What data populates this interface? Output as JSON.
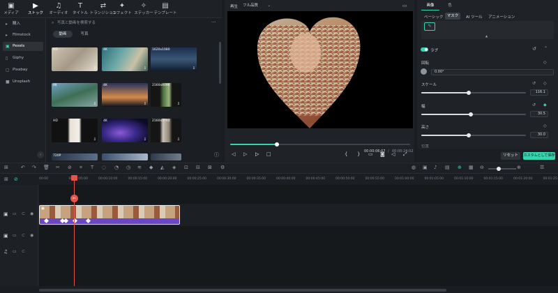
{
  "toolbar": {
    "tabs": [
      {
        "label": "メディア",
        "icon": "media-icon"
      },
      {
        "label": "ストック",
        "icon": "stock-icon"
      },
      {
        "label": "オーディオ",
        "icon": "audio-icon"
      },
      {
        "label": "タイトル",
        "icon": "title-icon"
      },
      {
        "label": "トランジション",
        "icon": "transition-icon"
      },
      {
        "label": "エフェクト",
        "icon": "effect-icon"
      },
      {
        "label": "ステッカー",
        "icon": "sticker-icon"
      },
      {
        "label": "テンプレート",
        "icon": "template-icon"
      }
    ]
  },
  "sidebar": {
    "items": [
      {
        "label": "購入"
      },
      {
        "label": "Filmstock"
      },
      {
        "label": "Pexels"
      },
      {
        "label": "Giphy"
      },
      {
        "label": "Pixabay"
      },
      {
        "label": "Unsplash"
      }
    ]
  },
  "library": {
    "search_placeholder": "写真と動画を検索する",
    "filters": [
      {
        "label": "動画"
      },
      {
        "label": "写真"
      }
    ],
    "thumbs": [
      {
        "badge": "HD"
      },
      {
        "badge": "4K"
      },
      {
        "badge": "1620x1080"
      },
      {
        "badge": "4K"
      },
      {
        "badge": "4K"
      },
      {
        "badge": "2160x4096"
      },
      {
        "badge": "HD"
      },
      {
        "badge": "4K"
      },
      {
        "badge": "2160x3744"
      },
      {
        "badge": "720P"
      },
      {
        "badge": ""
      },
      {
        "badge": ""
      }
    ]
  },
  "preview": {
    "title": "再生",
    "quality": "フル品質",
    "time_current": "00:00:06:07",
    "time_total": "00:00:24:02",
    "progress": 0.26
  },
  "inspector": {
    "top_tabs": [
      {
        "label": "画像"
      },
      {
        "label": "色"
      }
    ],
    "sub_tabs": [
      {
        "label": "ベーシック"
      },
      {
        "label": "マスク"
      },
      {
        "label": "AI ツール"
      },
      {
        "label": "アニメーション"
      }
    ],
    "section": "ラブ",
    "rotation_label": "回転",
    "rotation_value": "0.00°",
    "props": [
      {
        "label": "スケール",
        "value": "116.1",
        "fill": 0.45
      },
      {
        "label": "幅",
        "value": "30.5",
        "fill": 0.47
      },
      {
        "label": "高さ",
        "value": "30.0",
        "fill": 0.45
      }
    ],
    "partial_label": "位置",
    "reset_label": "リセット",
    "save_label": "カスタムとして保存"
  },
  "timeline": {
    "ticks": [
      "00:00",
      "00:00:05:00",
      "00:00:10:00",
      "00:00:15:00",
      "00:00:20:00",
      "00:00:25:00",
      "00:00:30:00",
      "00:00:35:00",
      "00:00:40:00",
      "00:00:45:00",
      "00:00:50:00",
      "00:00:55:00",
      "00:01:00:00",
      "00:01:05:00",
      "00:01:10:00",
      "00:01:15:00",
      "00:01:20:00",
      "00:01:25:00"
    ]
  },
  "colors": {
    "accent": "#35d5b0",
    "playhead": "#e5534b",
    "clip_purple": "#6a48c4",
    "clip_border": "#e8e8e8"
  }
}
